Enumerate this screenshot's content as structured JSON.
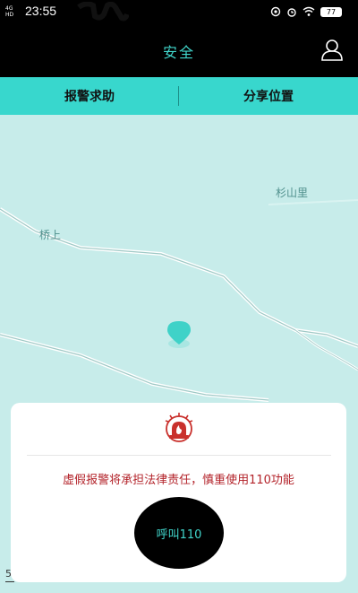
{
  "status_bar": {
    "network": "4G HD",
    "time": "23:55",
    "battery": "77"
  },
  "header": {
    "title": "安全",
    "user_icon": "user-icon"
  },
  "tabs": [
    {
      "label": "报警求助"
    },
    {
      "label": "分享位置"
    }
  ],
  "map": {
    "places": [
      "杉山里",
      "桥上"
    ],
    "location_marker_icon": "location-pin-icon",
    "scale_label": "5"
  },
  "panel": {
    "alarm_icon": "alarm-siren-icon",
    "warning": "虚假报警将承担法律责任，慎重使用110功能",
    "call_button_label": "呼叫110"
  },
  "colors": {
    "accent": "#41d6cc",
    "tab_bar": "#38d7cd",
    "map_bg": "#c7ecea",
    "warning_red": "#b3232a"
  }
}
